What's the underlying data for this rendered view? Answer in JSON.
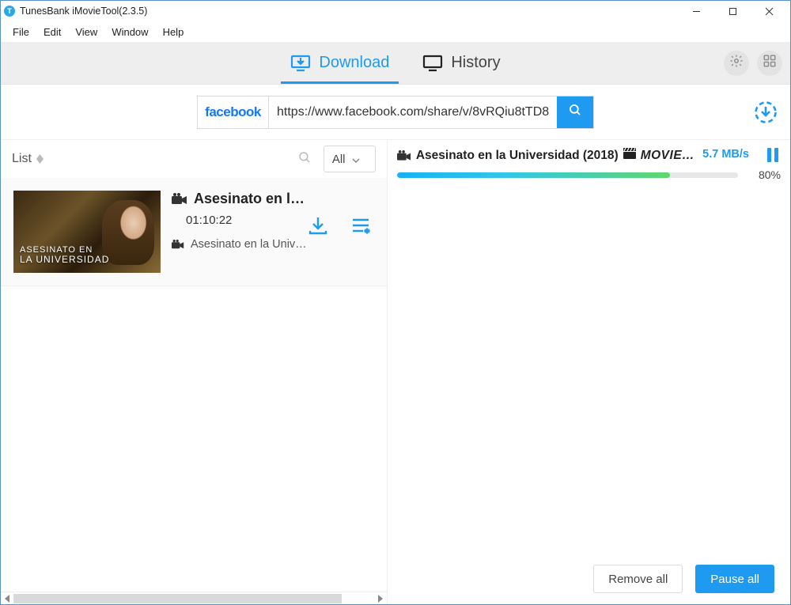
{
  "window": {
    "title": "TunesBank iMovieTool(2.3.5)"
  },
  "menu": {
    "items": [
      "File",
      "Edit",
      "View",
      "Window",
      "Help"
    ]
  },
  "tabs": {
    "download": "Download",
    "history": "History"
  },
  "search": {
    "source": "facebook",
    "url": "https://www.facebook.com/share/v/8vRQiu8tTD8"
  },
  "list": {
    "label": "List",
    "filter": "All",
    "items": [
      {
        "title_short": "Asesinato en l…",
        "duration": "01:10:22",
        "subtitle": "Asesinato en la Univ…",
        "thumb_caption_l1": "ASESINATO EN",
        "thumb_caption_l2": "LA UNIVERSIDAD"
      }
    ]
  },
  "downloads": {
    "items": [
      {
        "title_main": "Asesinato en la Universidad (2018)",
        "title_tag": "MOVIE…",
        "speed": "5.7 MB/s",
        "percent_label": "80%",
        "percent_value": 80
      }
    ],
    "remove_all": "Remove all",
    "pause_all": "Pause all"
  }
}
